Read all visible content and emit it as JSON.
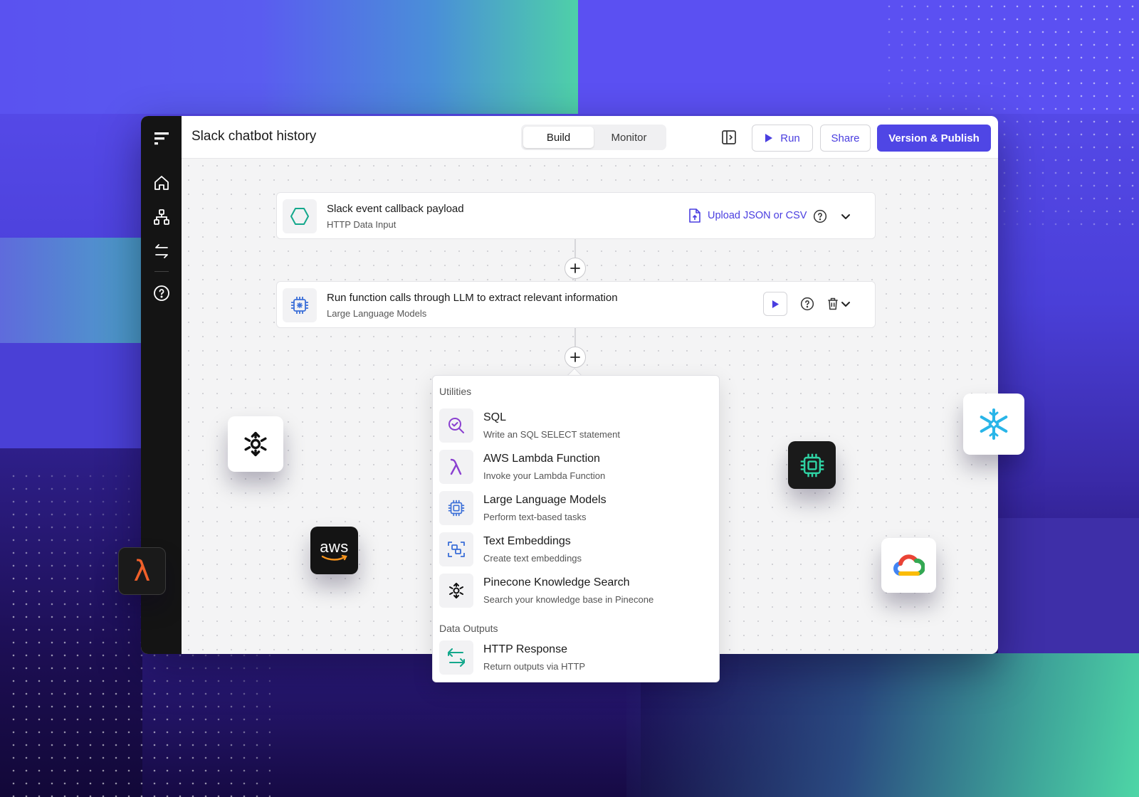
{
  "header": {
    "title": "Slack chatbot history",
    "tabs": [
      {
        "label": "Build",
        "active": true
      },
      {
        "label": "Monitor",
        "active": false
      }
    ],
    "run_label": "Run",
    "share_label": "Share",
    "publish_label": "Version & Publish"
  },
  "nodes": [
    {
      "title": "Slack event callback payload",
      "subtitle": "HTTP Data Input",
      "icon": "hexagon-icon",
      "action_label": "Upload JSON or CSV"
    },
    {
      "title": "Run function calls through LLM to extract relevant information",
      "subtitle": "Large Language Models",
      "icon": "chip-icon"
    }
  ],
  "menu": {
    "sections": [
      {
        "label": "Utilities",
        "items": [
          {
            "title": "SQL",
            "subtitle": "Write an SQL SELECT statement",
            "icon": "sql-search-icon"
          },
          {
            "title": "AWS Lambda Function",
            "subtitle": "Invoke your Lambda Function",
            "icon": "lambda-icon"
          },
          {
            "title": "Large Language Models",
            "subtitle": "Perform text-based tasks",
            "icon": "chip-icon"
          },
          {
            "title": "Text Embeddings",
            "subtitle": "Create text embeddings",
            "icon": "embeddings-icon"
          },
          {
            "title": "Pinecone Knowledge Search",
            "subtitle": "Search your knowledge base in Pinecone",
            "icon": "pinecone-icon"
          }
        ]
      },
      {
        "label": "Data Outputs",
        "items": [
          {
            "title": "HTTP Response",
            "subtitle": "Return outputs via HTTP",
            "icon": "http-response-icon"
          }
        ]
      }
    ]
  },
  "floating": {
    "aws_text": "aws",
    "lambda_glyph": "λ"
  },
  "colors": {
    "accent": "#4f46e5",
    "accent_text": "#4a3ee0",
    "rail": "#141414",
    "teal": "#14a88c"
  }
}
